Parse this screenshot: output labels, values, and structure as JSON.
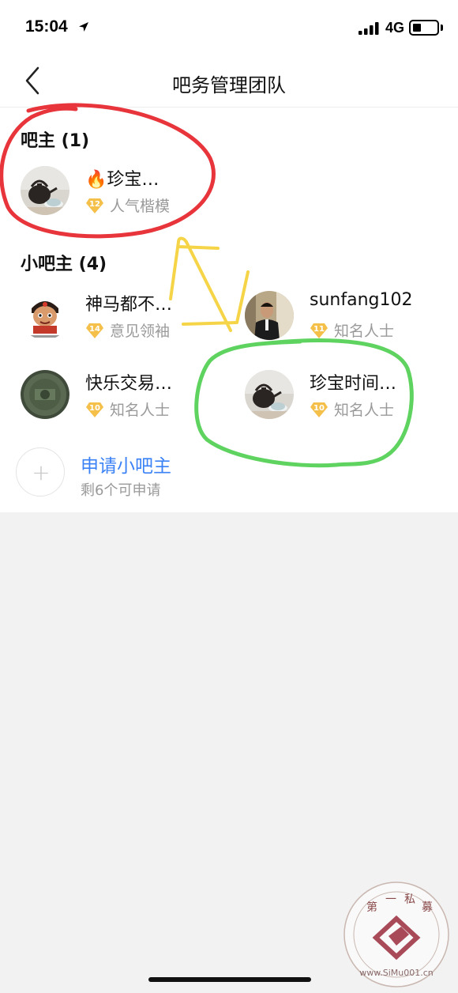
{
  "status_bar": {
    "time": "15:04",
    "network": "4G"
  },
  "nav": {
    "title": "吧务管理团队"
  },
  "owner_section": {
    "title": "吧主 (1)",
    "members": [
      {
        "name": "珍宝…",
        "level": "12",
        "title": "人气楷模",
        "flame": "🔥"
      }
    ]
  },
  "assistant_section": {
    "title": "小吧主 (4)",
    "members": [
      {
        "name": "神马都不…",
        "level": "14",
        "title": "意见领袖"
      },
      {
        "name": "sunfang102",
        "level": "11",
        "title": "知名人士"
      },
      {
        "name": "快乐交易…",
        "level": "10",
        "title": "知名人士"
      },
      {
        "name": "珍宝时间…",
        "level": "10",
        "title": "知名人士"
      }
    ]
  },
  "apply": {
    "label": "申请小吧主",
    "sub": "剩6个可申请",
    "icon": "plus-icon"
  },
  "watermark": {
    "top_text": [
      "第",
      "一",
      "私",
      "募"
    ],
    "url": "www.SiMu001.cn"
  },
  "colors": {
    "accent_blue": "#3b82f6",
    "badge_gold": "#f5c04a",
    "mark_red": "#e8353b",
    "mark_green": "#5fd35f",
    "mark_yellow": "#f5d547"
  }
}
